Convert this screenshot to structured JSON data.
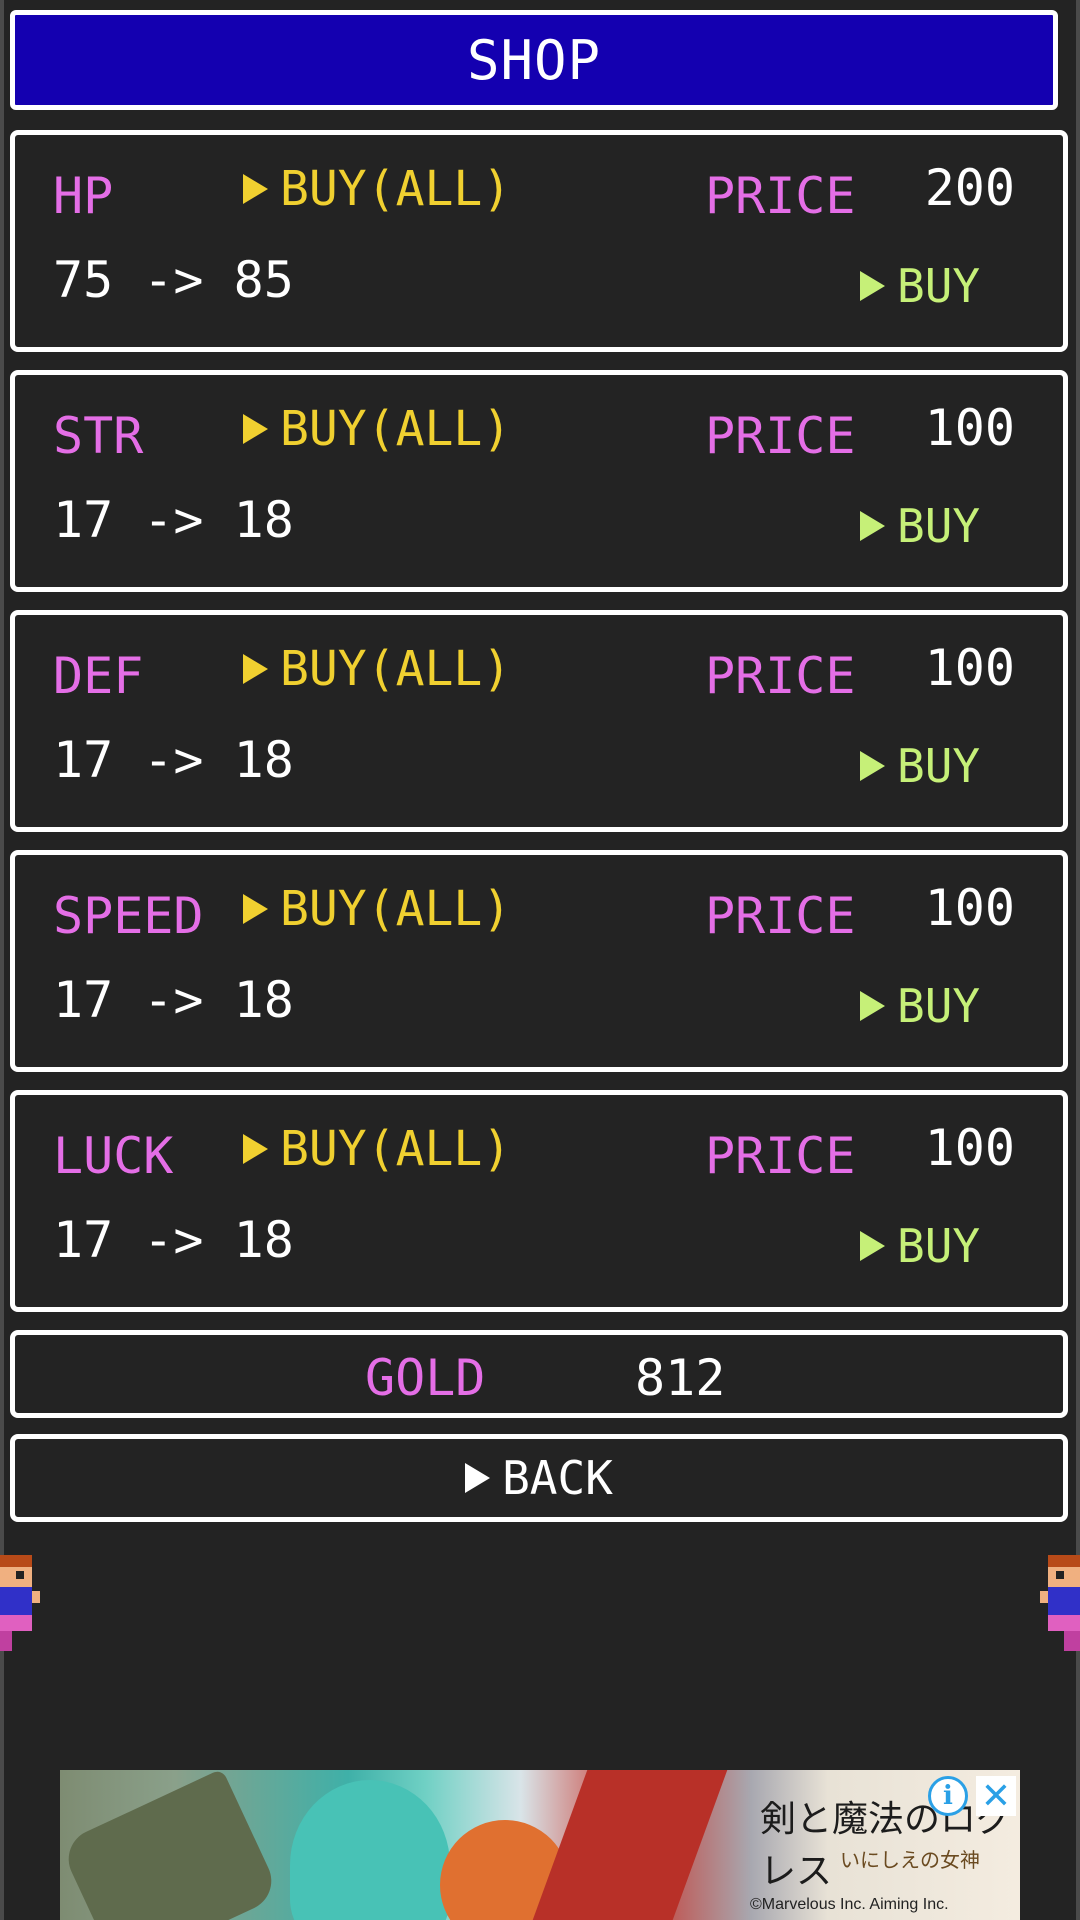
{
  "shop": {
    "title": "SHOP",
    "price_label": "PRICE",
    "buy_all_label": "BUY(ALL)",
    "buy_label": "BUY",
    "items": [
      {
        "stat": "HP",
        "change": "75 -> 85",
        "price": "200"
      },
      {
        "stat": "STR",
        "change": "17 -> 18",
        "price": "100"
      },
      {
        "stat": "DEF",
        "change": "17 -> 18",
        "price": "100"
      },
      {
        "stat": "SPEED",
        "change": "17 -> 18",
        "price": "100"
      },
      {
        "stat": "LUCK",
        "change": "17 -> 18",
        "price": "100"
      }
    ]
  },
  "gold": {
    "label": "GOLD",
    "value": "812"
  },
  "back": {
    "label": "BACK"
  },
  "ad": {
    "logo": "剣と魔法のログレス",
    "sublogo": "いにしえの女神",
    "copy": "©Marvelous Inc. Aiming Inc.",
    "info_icon": "i",
    "close_icon": "✕"
  },
  "colors": {
    "background": "#232323",
    "title_bar": "#1400b0",
    "stat_label": "#e46ee6",
    "buy_all": "#f0d030",
    "buy": "#c6f078"
  }
}
